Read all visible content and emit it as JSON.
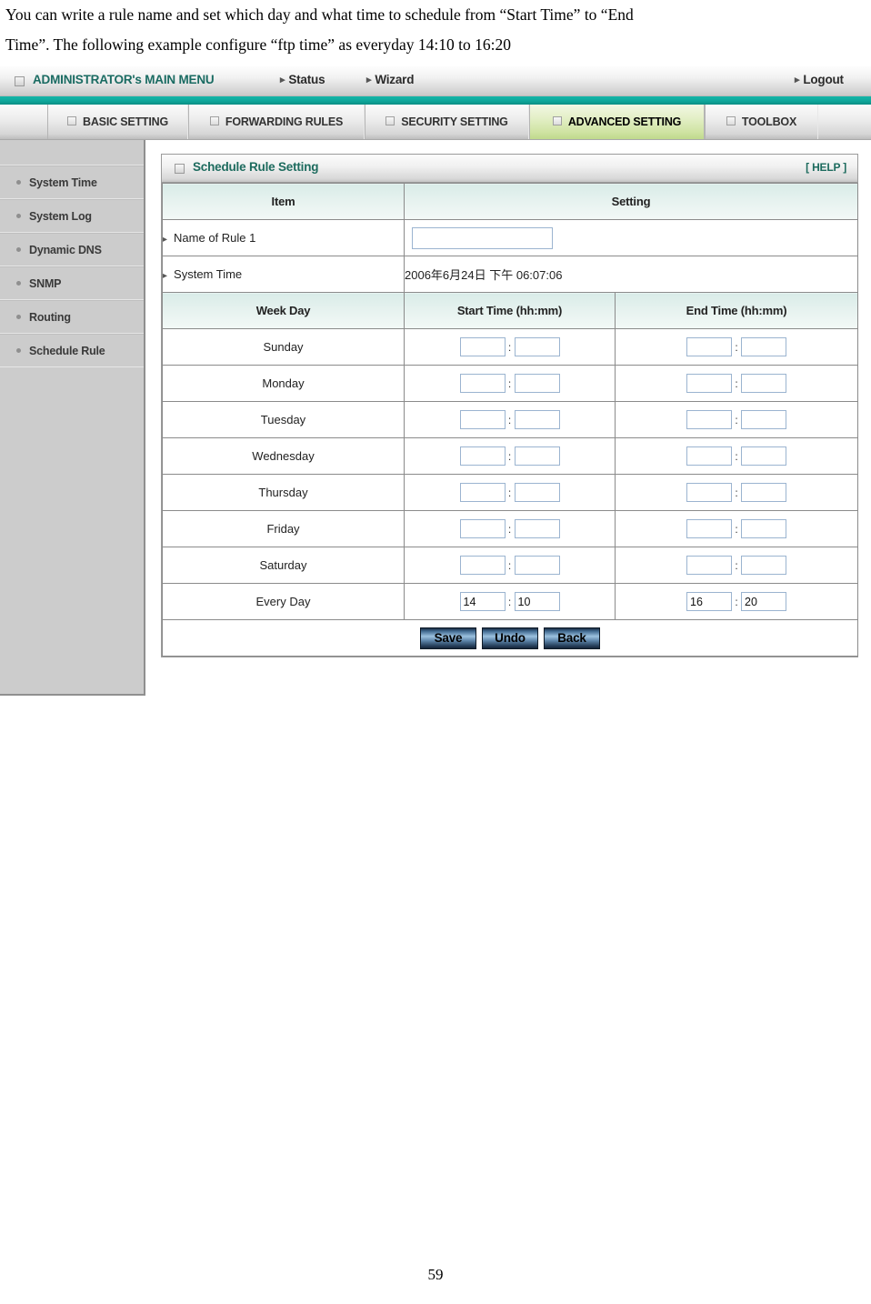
{
  "intro": {
    "line1": "You can write a rule name and set which day and what time to schedule from “Start Time” to “End",
    "line2": "Time”. The following example configure “ftp time” as everyday 14:10 to 16:20"
  },
  "topbar": {
    "admin_title": "ADMINISTRATOR's MAIN MENU",
    "status": "Status",
    "wizard": "Wizard",
    "logout": "Logout"
  },
  "tabs": [
    {
      "label": "BASIC SETTING",
      "active": false
    },
    {
      "label": "FORWARDING RULES",
      "active": false
    },
    {
      "label": "SECURITY SETTING",
      "active": false
    },
    {
      "label": "ADVANCED SETTING",
      "active": true
    },
    {
      "label": "TOOLBOX",
      "active": false
    }
  ],
  "sidebar": {
    "items": [
      {
        "label": "System Time"
      },
      {
        "label": "System Log"
      },
      {
        "label": "Dynamic DNS"
      },
      {
        "label": "SNMP"
      },
      {
        "label": "Routing"
      },
      {
        "label": "Schedule Rule"
      }
    ]
  },
  "panel": {
    "title": "Schedule Rule Setting",
    "help": "[ HELP ]",
    "headers": {
      "item": "Item",
      "setting": "Setting"
    },
    "rows": [
      {
        "label": "Name of Rule 1",
        "type": "input",
        "value": "",
        "placeholder": ""
      },
      {
        "label": "System Time",
        "type": "text",
        "value": "2006年6月24日 下午 06:07:06"
      }
    ],
    "schedule_headers": {
      "week_day": "Week Day",
      "start_time": "Start Time (hh:mm)",
      "end_time": "End Time (hh:mm)"
    },
    "schedule_rows": [
      {
        "day": "Sunday",
        "start_h": "",
        "start_m": "",
        "end_h": "",
        "end_m": ""
      },
      {
        "day": "Monday",
        "start_h": "",
        "start_m": "",
        "end_h": "",
        "end_m": ""
      },
      {
        "day": "Tuesday",
        "start_h": "",
        "start_m": "",
        "end_h": "",
        "end_m": ""
      },
      {
        "day": "Wednesday",
        "start_h": "",
        "start_m": "",
        "end_h": "",
        "end_m": ""
      },
      {
        "day": "Thursday",
        "start_h": "",
        "start_m": "",
        "end_h": "",
        "end_m": ""
      },
      {
        "day": "Friday",
        "start_h": "",
        "start_m": "",
        "end_h": "",
        "end_m": ""
      },
      {
        "day": "Saturday",
        "start_h": "",
        "start_m": "",
        "end_h": "",
        "end_m": ""
      },
      {
        "day": "Every Day",
        "start_h": "14",
        "start_m": "10",
        "end_h": "16",
        "end_m": "20"
      }
    ],
    "colon": ":",
    "buttons": [
      {
        "label": "Save"
      },
      {
        "label": "Undo"
      },
      {
        "label": "Back"
      }
    ]
  },
  "footer": {
    "page_number": "59"
  },
  "colors": {
    "accent_teal": "#0fa79b",
    "title_green": "#1d6b5e",
    "active_tab": "#cfe3a2",
    "sidebar_gray": "#cccccc",
    "header_cell": "#e6f2ef",
    "input_border": "#9bb4d0",
    "button_navy": "#2b4662"
  }
}
